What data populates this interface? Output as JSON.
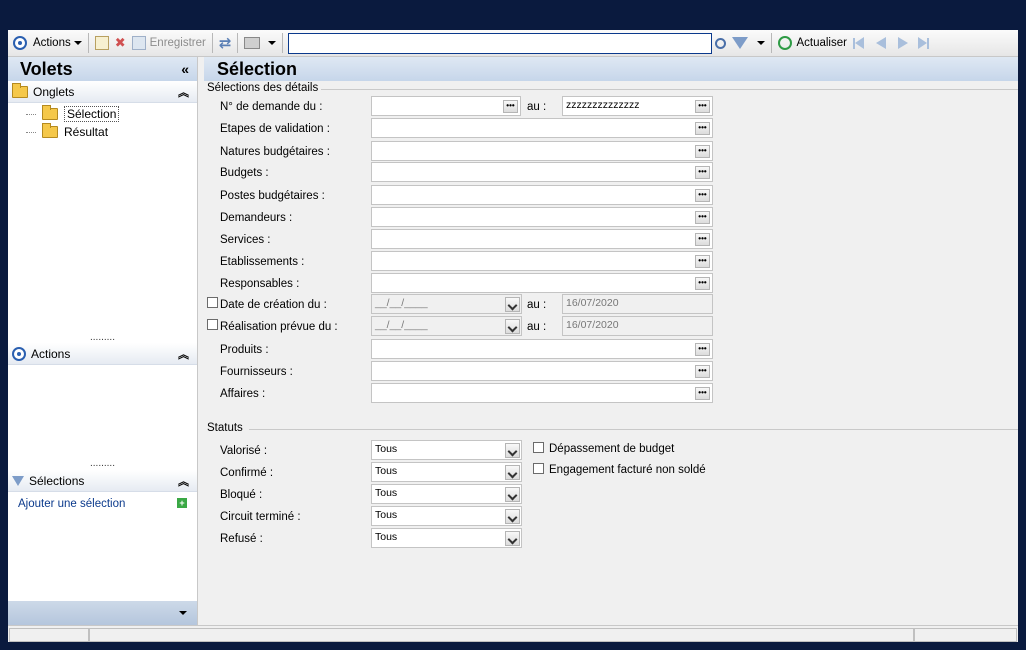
{
  "toolbar": {
    "actions_label": "Actions",
    "save_label": "Enregistrer",
    "search_value": "",
    "refresh_label": "Actualiser"
  },
  "left": {
    "title": "Volets",
    "collapse": "«",
    "onglets_label": "Onglets",
    "tree": [
      {
        "label": "Sélection",
        "selected": true
      },
      {
        "label": "Résultat",
        "selected": false
      }
    ],
    "actions_label": "Actions",
    "selections_label": "Sélections",
    "add_selection": "Ajouter une sélection",
    "chevron": "»"
  },
  "main": {
    "title": "Sélection",
    "details_group": "Sélections des détails",
    "statuts_group": "Statuts",
    "au": "au :",
    "demande": {
      "label": "N° de demande du :",
      "from": "",
      "to": "zzzzzzzzzzzzzz"
    },
    "fields": [
      {
        "label": "Etapes de validation :",
        "value": ""
      },
      {
        "label": "Natures budgétaires :",
        "value": ""
      },
      {
        "label": "Budgets :",
        "value": ""
      },
      {
        "label": "Postes budgétaires :",
        "value": ""
      },
      {
        "label": "Demandeurs :",
        "value": ""
      },
      {
        "label": "Services :",
        "value": ""
      },
      {
        "label": "Etablissements :",
        "value": ""
      },
      {
        "label": "Responsables :",
        "value": ""
      }
    ],
    "date_creation": {
      "label": "Date de création du :",
      "from": "__/__/____",
      "to": "16/07/2020"
    },
    "realisation": {
      "label": "Réalisation prévue du :",
      "from": "__/__/____",
      "to": "16/07/2020"
    },
    "fields2": [
      {
        "label": "Produits :",
        "value": ""
      },
      {
        "label": "Fournisseurs :",
        "value": ""
      },
      {
        "label": "Affaires :",
        "value": ""
      }
    ],
    "statuts": [
      {
        "label": "Valorisé :",
        "value": "Tous"
      },
      {
        "label": "Confirmé :",
        "value": "Tous"
      },
      {
        "label": "Bloqué :",
        "value": "Tous"
      },
      {
        "label": "Circuit terminé :",
        "value": "Tous"
      },
      {
        "label": "Refusé :",
        "value": "Tous"
      }
    ],
    "depassement": "Dépassement de budget",
    "engagement": "Engagement facturé non soldé"
  }
}
